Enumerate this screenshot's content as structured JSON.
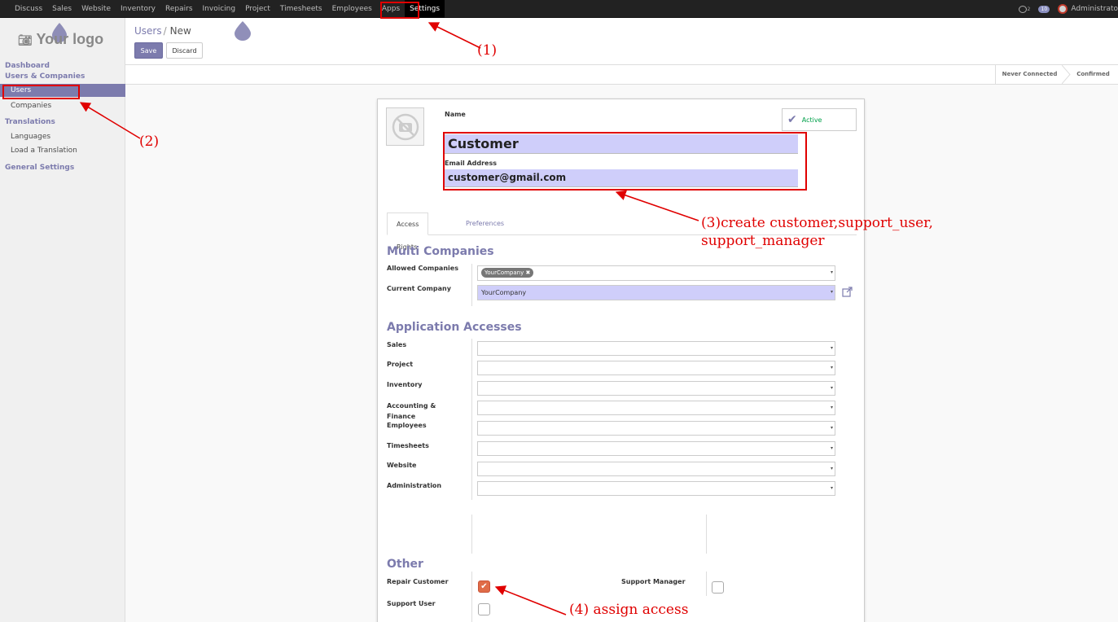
{
  "topbar": {
    "menu": [
      "Discuss",
      "Sales",
      "Website",
      "Inventory",
      "Repairs",
      "Invoicing",
      "Project",
      "Timesheets",
      "Employees",
      "Apps",
      "Settings"
    ],
    "active": "Settings",
    "chat_badge": "2",
    "activity_badge": "10",
    "user": "Administrato"
  },
  "sidebar": {
    "logo": "Your logo",
    "dashboard": "Dashboard",
    "users_companies": "Users & Companies",
    "users": "Users",
    "companies": "Companies",
    "translations": "Translations",
    "languages": "Languages",
    "load_translation": "Load a Translation",
    "general_settings": "General Settings"
  },
  "control_panel": {
    "breadcrumb_parent": "Users",
    "breadcrumb_sep": "/",
    "breadcrumb_current": "New",
    "save_label": "Save",
    "discard_label": "Discard"
  },
  "statusbar": {
    "stages": [
      "Never Connected",
      "Confirmed"
    ]
  },
  "form": {
    "name_label": "Name",
    "name_value": "Customer",
    "email_label": "Email Address",
    "email_value": "customer@gmail.com",
    "active_label": "Active",
    "tabs": [
      "Access Rights",
      "Preferences"
    ],
    "multi_companies": {
      "title": "Multi Companies",
      "allowed_label": "Allowed Companies",
      "allowed_tag": "YourCompany",
      "current_label": "Current Company",
      "current_value": "YourCompany"
    },
    "app_accesses": {
      "title": "Application Accesses",
      "fields": [
        "Sales",
        "Project",
        "Inventory",
        "Accounting & Finance",
        "Employees",
        "Timesheets",
        "Website",
        "Administration"
      ]
    },
    "other": {
      "title": "Other",
      "repair_customer": "Repair Customer",
      "support_manager": "Support Manager",
      "support_user": "Support User",
      "repair_customer_checked": true,
      "support_manager_checked": false,
      "support_user_checked": false
    }
  },
  "annotations": {
    "a1": "(1)",
    "a2": "(2)",
    "a3_line1": "(3)create customer,support_user,",
    "a3_line2": "support_manager",
    "a4": "(4) assign access"
  },
  "colors": {
    "brand": "#7c7bad",
    "annotation": "#e00000",
    "checkbox_on": "#e06c47"
  }
}
